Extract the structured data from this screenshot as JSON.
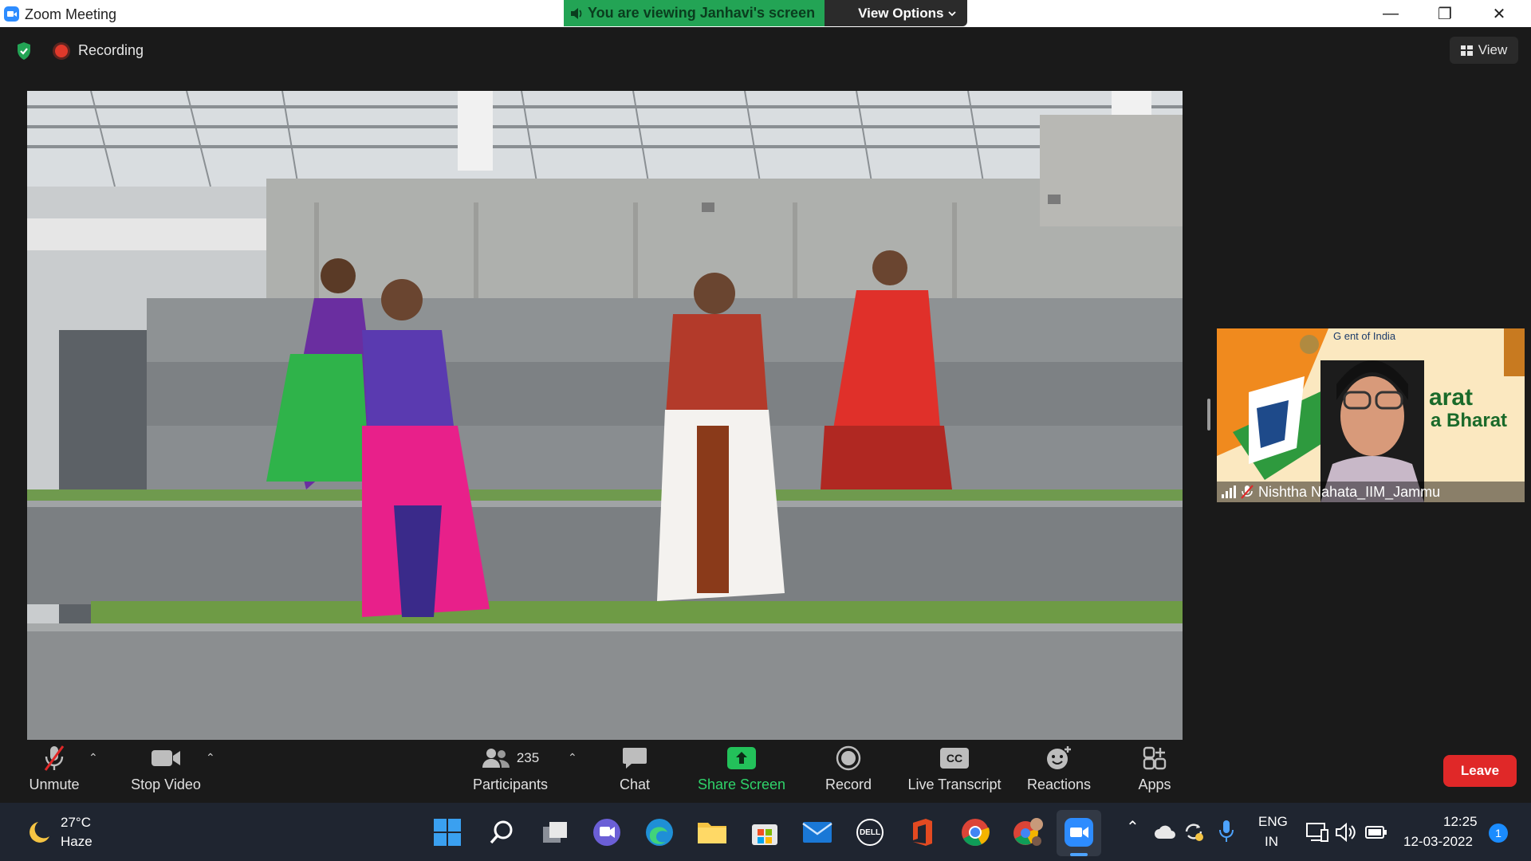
{
  "window": {
    "title": "Zoom Meeting",
    "minimize_glyph": "—",
    "restore_glyph": "❐",
    "close_glyph": "✕"
  },
  "banner": {
    "viewing_text": "You are viewing Janhavi's screen",
    "view_options_label": "View Options"
  },
  "status": {
    "recording_label": "Recording",
    "view_label": "View"
  },
  "participant_tile": {
    "name": "Nishtha Nahata_IIM_Jammu",
    "background_text_line1": "arat",
    "background_text_line2": "a Bharat",
    "background_text_header": "G        ent of India"
  },
  "toolbar": {
    "unmute_label": "Unmute",
    "stop_video_label": "Stop Video",
    "participants_label": "Participants",
    "participants_count": "235",
    "chat_label": "Chat",
    "share_screen_label": "Share Screen",
    "record_label": "Record",
    "live_transcript_label": "Live Transcript",
    "reactions_label": "Reactions",
    "apps_label": "Apps",
    "leave_label": "Leave",
    "cc_text": "CC"
  },
  "taskbar": {
    "temperature": "27°C",
    "weather": "Haze",
    "language_top": "ENG",
    "language_bottom": "IN",
    "time": "12:25",
    "date": "12-03-2022",
    "notification_count": "1",
    "dell_text": "DELL"
  },
  "colors": {
    "accent_green": "#23a455",
    "share_green": "#2fd36a",
    "leave_red": "#e02828",
    "zoom_blue": "#2d8cff"
  }
}
